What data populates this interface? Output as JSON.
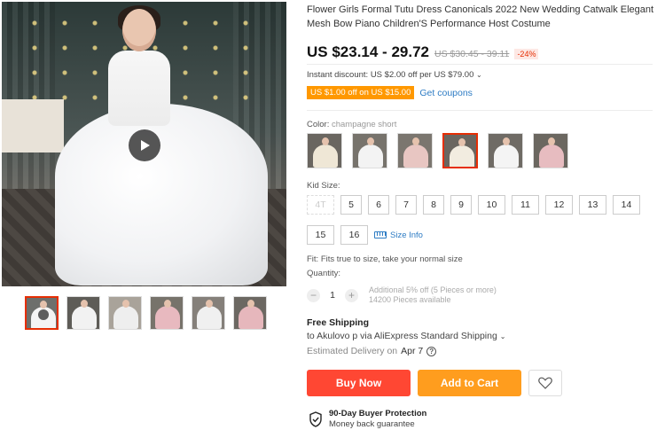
{
  "product": {
    "title": "Flower Girls Formal Tutu Dress Canonicals 2022 New Wedding Catwalk Elegant Mesh Bow Piano Children'S Performance Host Costume"
  },
  "gallery": {
    "thumbnails": [
      {
        "label": "video",
        "dress_color": "#f4f4f4",
        "bg": "#6d6f6c",
        "active": true
      },
      {
        "label": "white",
        "dress_color": "#f2f2f2",
        "bg": "#5e5c57"
      },
      {
        "label": "white-2",
        "dress_color": "#eeeeee",
        "bg": "#a9a39a"
      },
      {
        "label": "pink",
        "dress_color": "#e8b9bf",
        "bg": "#77736b"
      },
      {
        "label": "white-3",
        "dress_color": "#f0f0f0",
        "bg": "#85807a"
      },
      {
        "label": "pink-2",
        "dress_color": "#e6b7bc",
        "bg": "#6c6862"
      }
    ]
  },
  "pricing": {
    "price": "US $23.14 - 29.72",
    "original_price": "US $30.45 - 39.11",
    "discount": "-24%",
    "instant_discount": "Instant discount: US $2.00 off per US $79.00",
    "coupon_tag": "US $1.00 off on US $15.00",
    "get_coupons": "Get coupons"
  },
  "color": {
    "label": "Color:",
    "selected": "champagne short",
    "options": [
      {
        "dress_color": "#efe7d6",
        "bg": "#6a6660"
      },
      {
        "dress_color": "#f3f3f3",
        "bg": "#77736c"
      },
      {
        "dress_color": "#e8c6c2",
        "bg": "#7b766f"
      },
      {
        "dress_color": "#f2ece0",
        "bg": "#6a6660",
        "active": true
      },
      {
        "dress_color": "#f4f4f4",
        "bg": "#6f6b65"
      },
      {
        "dress_color": "#e7bcc0",
        "bg": "#6b6760"
      }
    ]
  },
  "size": {
    "label": "Kid Size:",
    "options": [
      {
        "v": "4T",
        "disabled": true
      },
      {
        "v": "5"
      },
      {
        "v": "6"
      },
      {
        "v": "7"
      },
      {
        "v": "8"
      },
      {
        "v": "9"
      },
      {
        "v": "10"
      },
      {
        "v": "11"
      },
      {
        "v": "12"
      },
      {
        "v": "13"
      },
      {
        "v": "14"
      },
      {
        "v": "15"
      },
      {
        "v": "16"
      }
    ],
    "size_info": "Size Info"
  },
  "fit": "Fit: Fits true to size, take your normal size",
  "quantity": {
    "label": "Quantity:",
    "minus": "−",
    "value": "1",
    "plus": "+",
    "note1": "Additional 5% off (5 Pieces or more)",
    "note2": "14200 Pieces available"
  },
  "shipping": {
    "title": "Free Shipping",
    "to": "to Akulovo p via AliExpress Standard Shipping",
    "estimated_label": "Estimated Delivery on",
    "estimated_date": "Apr 7",
    "help": "?"
  },
  "actions": {
    "buy_now": "Buy Now",
    "add_to_cart": "Add to Cart"
  },
  "protection": {
    "title": "90-Day Buyer Protection",
    "subtitle": "Money back guarantee"
  },
  "colors": {
    "accent_red": "#e62e04",
    "buy_now_bg": "#ff4733",
    "add_cart_bg": "#ff9d1e",
    "coupon_bg": "#ff9800",
    "link_blue": "#2e7cc4"
  }
}
